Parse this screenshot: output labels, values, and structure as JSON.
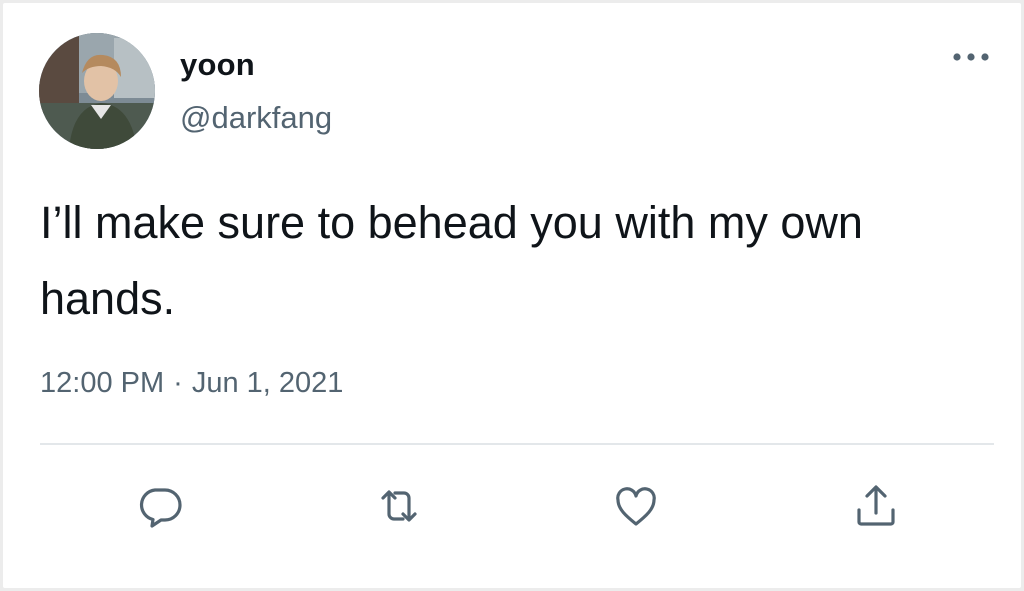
{
  "tweet": {
    "author": {
      "display_name": "yoon",
      "handle": "@darkfang",
      "avatar_icon": "profile-photo"
    },
    "more_icon": "more-horizontal-icon",
    "text": "I’ll make sure to behead you with my own hands.",
    "time": "12:00 PM",
    "separator": "·",
    "date": "Jun 1, 2021",
    "actions": [
      {
        "name": "reply",
        "icon": "speech-bubble-icon"
      },
      {
        "name": "retweet",
        "icon": "retweet-icon"
      },
      {
        "name": "like",
        "icon": "heart-icon"
      },
      {
        "name": "share",
        "icon": "share-upload-icon"
      }
    ]
  },
  "colors": {
    "text_primary": "#0f1419",
    "text_secondary": "#536471",
    "divider": "#e3e7ea",
    "background": "#ffffff"
  }
}
